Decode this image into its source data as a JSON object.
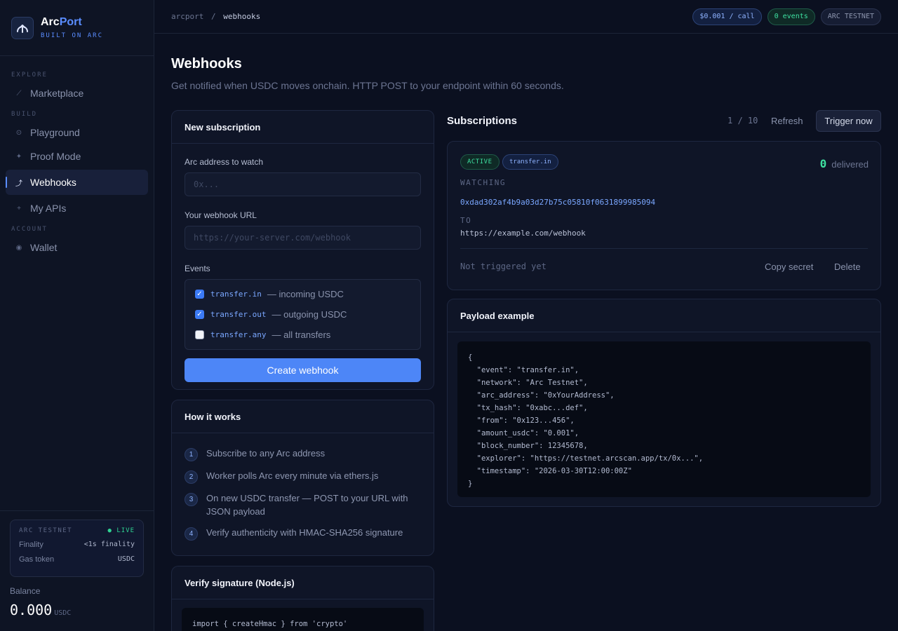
{
  "brand": {
    "name_part1": "Arc",
    "name_part2": "Port",
    "tagline": "BUILT ON ARC"
  },
  "nav": {
    "sections": {
      "explore": "EXPLORE",
      "build": "BUILD",
      "account": "ACCOUNT"
    },
    "items": {
      "marketplace": "Marketplace",
      "playground": "Playground",
      "proof_mode": "Proof Mode",
      "webhooks": "Webhooks",
      "my_apis": "My APIs",
      "wallet": "Wallet"
    },
    "active": "Webhooks"
  },
  "network": {
    "label": "ARC TESTNET",
    "status": "● LIVE",
    "finality_label": "Finality",
    "finality_value": "<1s finality",
    "gas_label": "Gas token",
    "gas_value": "USDC"
  },
  "balance": {
    "label": "Balance",
    "value": "0.000",
    "unit": "USDC"
  },
  "topbar": {
    "breadcrumb_root": "arcport",
    "breadcrumb_sep": "/",
    "breadcrumb_current": "webhooks",
    "price_pill": "$0.001 / call",
    "events_pill": "0 events",
    "network_pill": "ARC TESTNET"
  },
  "page": {
    "title": "Webhooks",
    "subtitle": "Get notified when USDC moves onchain. HTTP POST to your endpoint within 60 seconds."
  },
  "new_subscription": {
    "title": "New subscription",
    "address_label": "Arc address to watch",
    "address_placeholder": "0x...",
    "url_label": "Your webhook URL",
    "url_placeholder": "https://your-server.com/webhook",
    "events_label": "Events",
    "events": [
      {
        "name": "transfer.in",
        "desc": "— incoming USDC",
        "checked": true
      },
      {
        "name": "transfer.out",
        "desc": "— outgoing USDC",
        "checked": true
      },
      {
        "name": "transfer.any",
        "desc": "— all transfers",
        "checked": false
      }
    ],
    "create_button": "Create webhook"
  },
  "how_it_works": {
    "title": "How it works",
    "steps": [
      {
        "num": "1",
        "text": "Subscribe to any Arc address"
      },
      {
        "num": "2",
        "text": "Worker polls Arc every minute via ethers.js"
      },
      {
        "num": "3",
        "text": "On new USDC transfer — POST to your URL with JSON payload"
      },
      {
        "num": "4",
        "text": "Verify authenticity with HMAC-SHA256 signature"
      }
    ]
  },
  "verify": {
    "title": "Verify signature (Node.js)",
    "code": "import { createHmac } from 'crypto'"
  },
  "subscriptions": {
    "title": "Subscriptions",
    "count": "1 / 10",
    "refresh": "Refresh",
    "trigger": "Trigger now",
    "items": [
      {
        "status": "ACTIVE",
        "event": "transfer.in",
        "delivered_count": "0",
        "delivered_label": "delivered",
        "watching_label": "WATCHING",
        "address": "0xdad302af4b9a03d27b75c05810f0631899985094",
        "to_label": "TO",
        "url": "https://example.com/webhook",
        "last": "Not triggered yet",
        "copy_secret": "Copy secret",
        "delete": "Delete"
      }
    ]
  },
  "payload": {
    "title": "Payload example",
    "code": "{\n  \"event\": \"transfer.in\",\n  \"network\": \"Arc Testnet\",\n  \"arc_address\": \"0xYourAddress\",\n  \"tx_hash\": \"0xabc...def\",\n  \"from\": \"0x123...456\",\n  \"amount_usdc\": \"0.001\",\n  \"block_number\": 12345678,\n  \"explorer\": \"https://testnet.arcscan.app/tx/0x...\",\n  \"timestamp\": \"2026-03-30T12:00:00Z\"\n}"
  },
  "colors": {
    "accent": "#4d86f7",
    "success": "#3ee0a0",
    "background": "#0b1020"
  }
}
